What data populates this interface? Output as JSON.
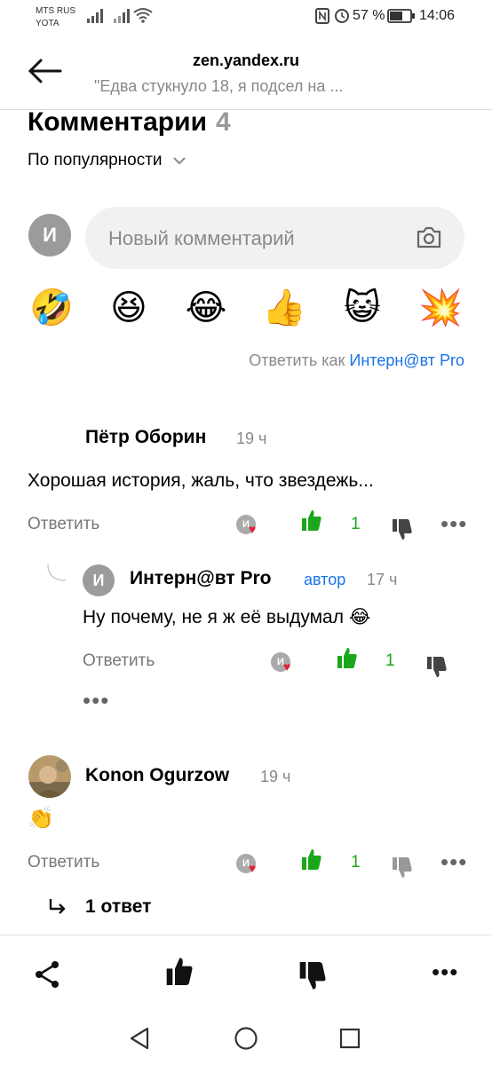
{
  "status_bar": {
    "carrier1": "MTS RUS",
    "carrier2": "YOTA",
    "battery": "57 %",
    "time": "14:06"
  },
  "header": {
    "domain": "zen.yandex.ru",
    "subtitle": "\"Едва стукнуло 18, я подсел на ..."
  },
  "comments_header": {
    "title": "Комментарии",
    "count": "4",
    "sort_label": "По популярности"
  },
  "new_comment": {
    "avatar_letter": "И",
    "placeholder": "Новый комментарий"
  },
  "reactions": [
    "🤣",
    "😆",
    "😂",
    "👍",
    "😺",
    "💥"
  ],
  "reply_as": {
    "prefix": "Ответить как",
    "account": "Интерн@вт Pro"
  },
  "comments": [
    {
      "name": "Пётр Оборин",
      "time": "19 ч",
      "text": "Хорошая история, жаль, что звездежь...",
      "reply_label": "Ответить",
      "likes": "1"
    },
    {
      "avatar_letter": "И",
      "name": "Интерн@вт Pro",
      "author_tag": "автор",
      "time": "17 ч",
      "text": "Ну почему, не я ж её выдумал 😂",
      "reply_label": "Ответить",
      "likes": "1"
    },
    {
      "name": "Konon Ogurzow",
      "time": "19 ч",
      "text": "👏",
      "reply_label": "Ответить",
      "likes": "1",
      "replies_link": "1 ответ"
    }
  ],
  "mini_avatar_letter": "И",
  "colors": {
    "accent_blue": "#1a73e8",
    "like_green": "#1aa81a",
    "heart_red": "#e0243b"
  }
}
